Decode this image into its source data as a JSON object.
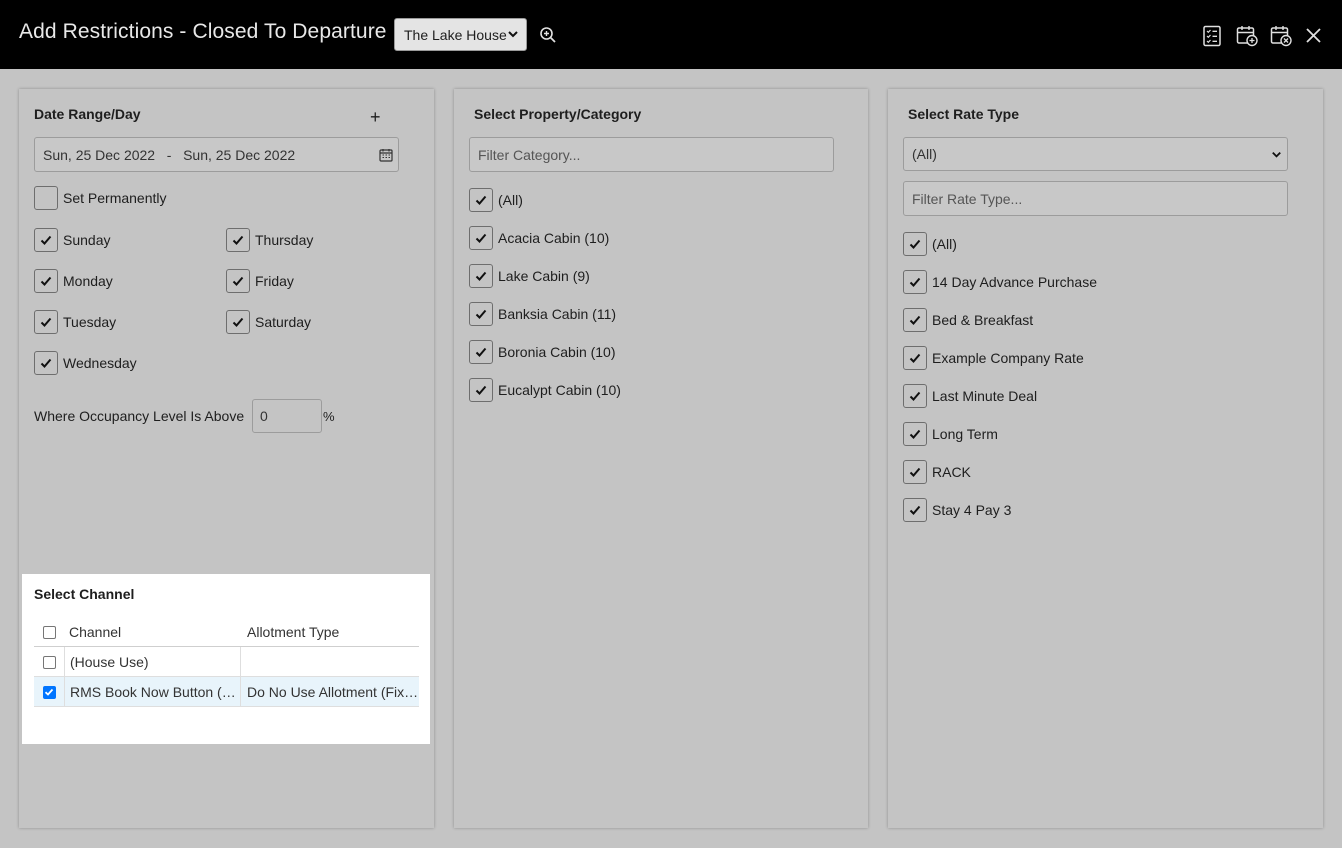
{
  "header": {
    "title": "Add Restrictions - Closed To Departure",
    "property_select": "The Lake House"
  },
  "date_panel": {
    "heading": "Date Range/Day",
    "add_label": "+",
    "date_range": "Sun, 25 Dec 2022   -   Sun, 25 Dec 2022",
    "set_permanently": "Set Permanently",
    "days": {
      "sunday": "Sunday",
      "thursday": "Thursday",
      "monday": "Monday",
      "friday": "Friday",
      "tuesday": "Tuesday",
      "saturday": "Saturday",
      "wednesday": "Wednesday"
    },
    "occupancy_label": "Where Occupancy Level Is Above",
    "occupancy_value": "0",
    "occupancy_unit": "%"
  },
  "channel": {
    "heading": "Select Channel",
    "columns": [
      "Channel",
      "Allotment Type"
    ],
    "rows": [
      {
        "channel": "(House Use)",
        "allotment": ""
      },
      {
        "channel": "RMS Book Now Button (RMS Book Now Button)",
        "allotment": "Do No Use Allotment (Fixed)"
      }
    ]
  },
  "category_panel": {
    "heading": "Select Property/Category",
    "filter_placeholder": "Filter Category...",
    "items": [
      "(All)",
      "Acacia Cabin (10)",
      "Lake Cabin (9)",
      "Banksia Cabin (11)",
      "Boronia Cabin (10)",
      "Eucalypt Cabin (10)"
    ]
  },
  "rate_panel": {
    "heading": "Select Rate Type",
    "rate_select": "(All)",
    "filter_placeholder": "Filter Rate Type...",
    "items": [
      "(All)",
      "14 Day Advance Purchase",
      "Bed & Breakfast",
      "Example Company Rate",
      "Last Minute Deal",
      "Long Term",
      "RACK",
      "Stay 4 Pay 3"
    ]
  }
}
